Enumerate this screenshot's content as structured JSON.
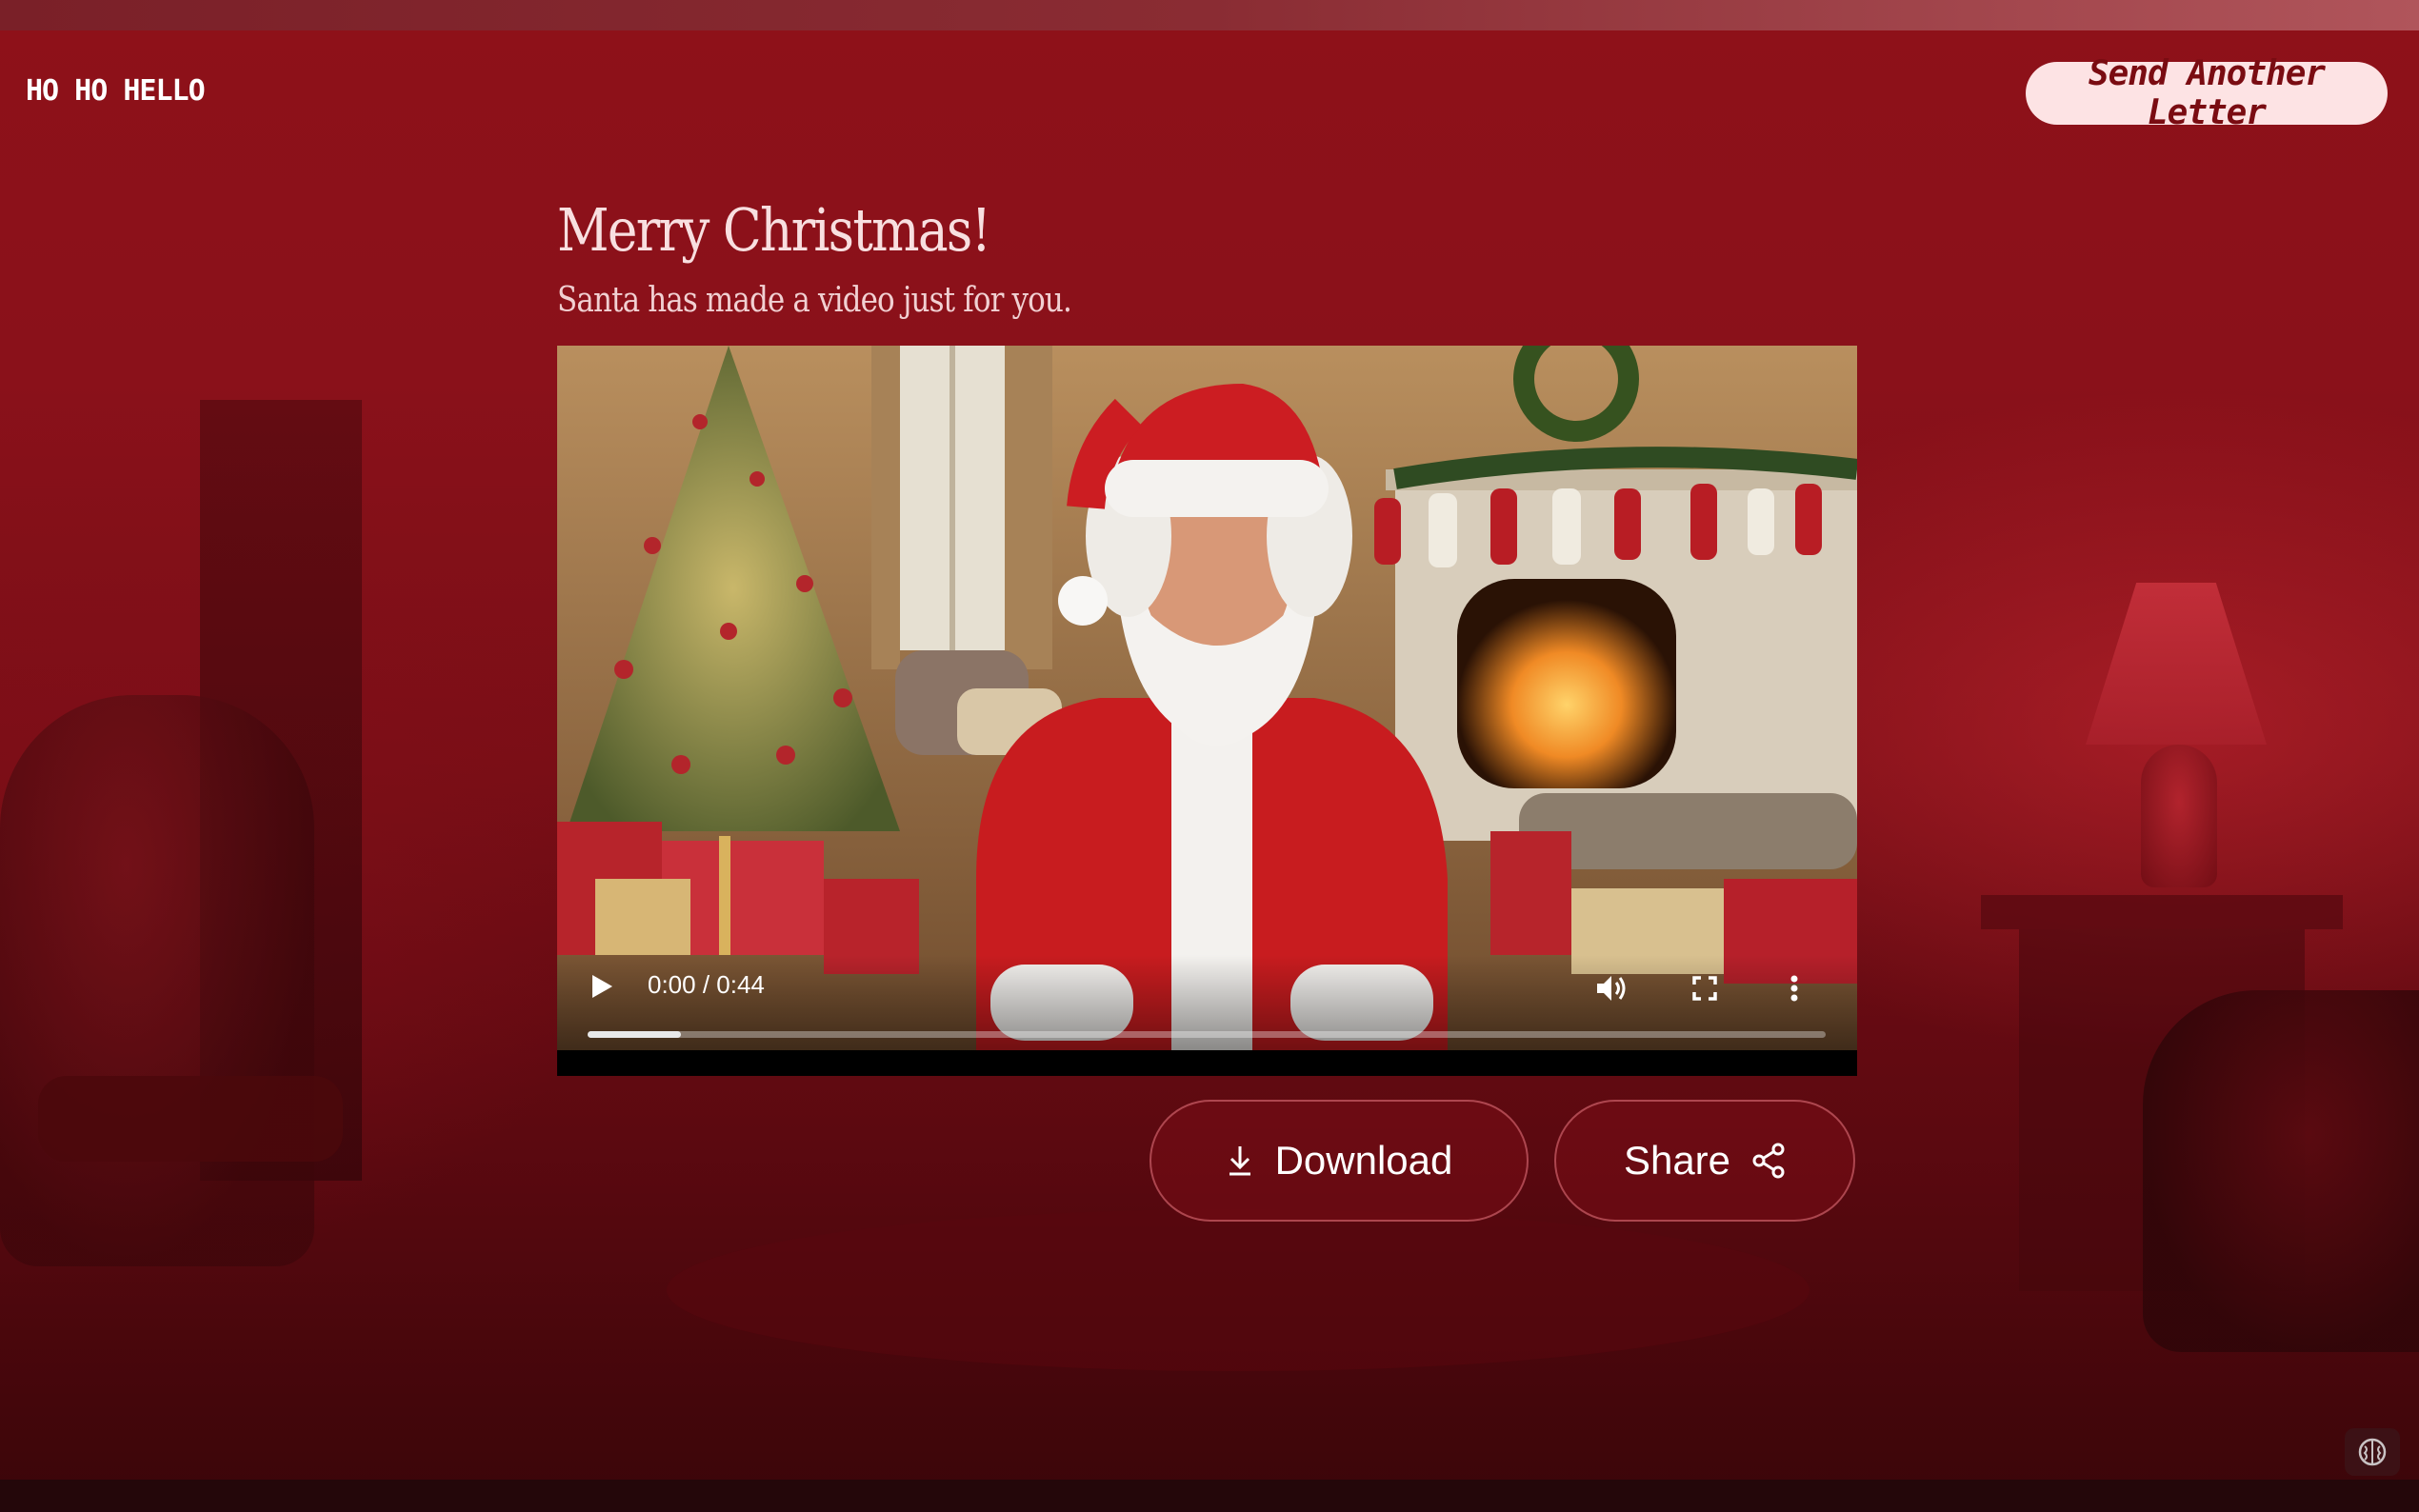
{
  "header": {
    "logo_text": "HO HO HELLO",
    "send_another_label": "Send Another Letter"
  },
  "main": {
    "title": "Merry Christmas!",
    "subtitle": "Santa has made a video just for you."
  },
  "video": {
    "time_display": "0:00 / 0:44",
    "progress_fraction": 0.075,
    "icons": {
      "play": "play-icon",
      "volume": "volume-icon",
      "fullscreen": "fullscreen-icon",
      "more": "more-options-icon"
    }
  },
  "actions": {
    "download_label": "Download",
    "share_label": "Share"
  },
  "colors": {
    "background": "#8e1119",
    "send_button_bg": "#fde3e4",
    "send_button_text": "#7a0c12",
    "heading_text": "#f8dfe0"
  }
}
